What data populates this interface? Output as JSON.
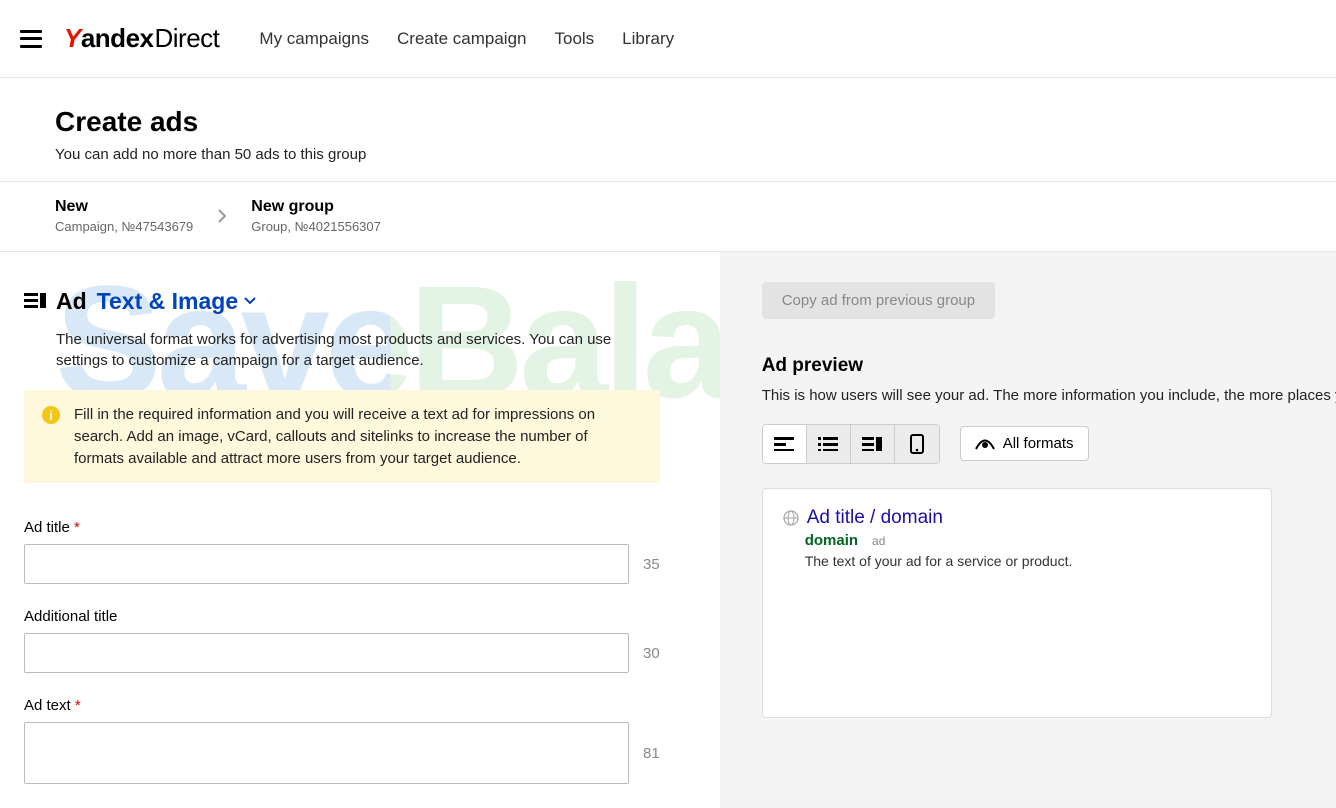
{
  "watermark": "SaveBalance",
  "header": {
    "nav": [
      "My campaigns",
      "Create campaign",
      "Tools",
      "Library"
    ],
    "logo": {
      "y": "Y",
      "andex": "andex",
      "direct": "Direct"
    }
  },
  "title": {
    "heading": "Create ads",
    "sub": "You can add no more than 50 ads to this group"
  },
  "breadcrumb": {
    "a": {
      "top": "New",
      "bot": "Campaign, №47543679"
    },
    "b": {
      "top": "New group",
      "bot": "Group, №4021556307"
    }
  },
  "ad": {
    "word": "Ad",
    "type": "Text & Image",
    "desc": "The universal format works for advertising most products and services. You can use settings to customize a campaign for a target audience.",
    "info": "Fill in the required information and you will receive a text ad for impressions on search. Add an image, vCard, callouts and sitelinks to increase the number of formats available and attract more users from your target audience."
  },
  "fields": {
    "title": {
      "label": "Ad title",
      "required": true,
      "count": "35"
    },
    "addl": {
      "label": "Additional title",
      "required": false,
      "count": "30"
    },
    "text": {
      "label": "Ad text",
      "required": true,
      "count": "81"
    }
  },
  "right": {
    "copy": "Copy ad from previous group",
    "previewh": "Ad preview",
    "previewsub": "This is how users will see your ad. The more information you include, the more places y",
    "allformats": "All formats",
    "card": {
      "title": "Ad title / domain",
      "domain": "domain",
      "adtag": "ad",
      "text": "The text of your ad for a service or product."
    }
  }
}
